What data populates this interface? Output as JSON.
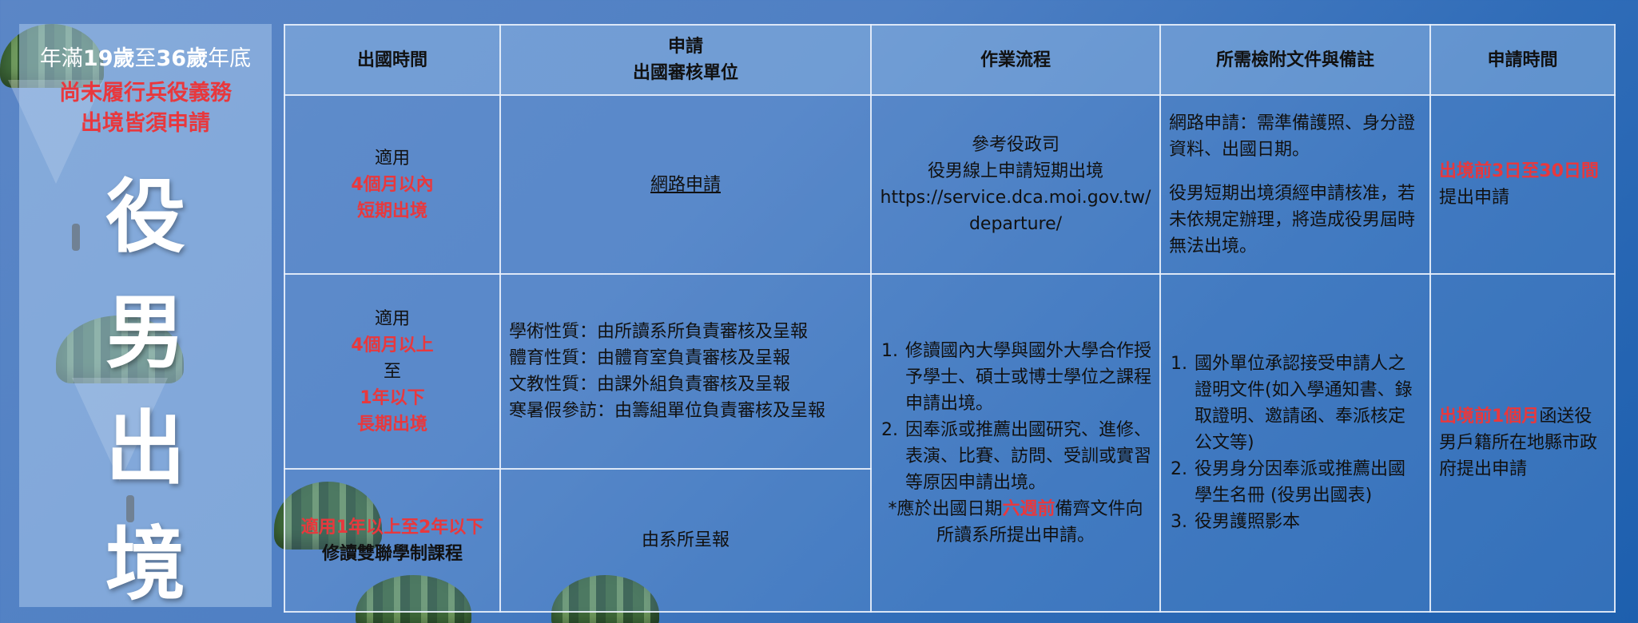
{
  "sidebar": {
    "line1_a": "年滿",
    "line1_b": "19歲",
    "line1_c": "至",
    "line1_d": "36歲",
    "line1_e": "年底",
    "line2": "尚未履行兵役義務",
    "line3": "出境皆須申請",
    "char1": "役",
    "char2": "男",
    "char3": "出",
    "char4": "境"
  },
  "table": {
    "headers": {
      "time": "出國時間",
      "unit_line1": "申請",
      "unit_line2": "出國審核單位",
      "process": "作業流程",
      "docs": "所需檢附文件與備註",
      "apply_time": "申請時間"
    },
    "row1": {
      "time_a": "適用",
      "time_b": "4個月以內",
      "time_c": "短期出境",
      "unit": "網路申請",
      "process_1": "參考役政司",
      "process_2": "役男線上申請短期出境",
      "process_3": "https://service.dca.moi.gov.tw/",
      "process_4": "departure/",
      "docs_1": "網路申請：需準備護照、身分證資料、出國日期。",
      "docs_2": "役男短期出境須經申請核准，若未依規定辦理，將造成役男屆時無法出境。",
      "apply_red": "出境前3日至30日間",
      "apply_rest": "提出申請"
    },
    "row2": {
      "time_a": "適用",
      "time_b": "4個月以上",
      "time_c": "至",
      "time_d": "1年以下",
      "time_e": "長期出境",
      "unit_1": "學術性質：由所讀系所負責審核及呈報",
      "unit_2": "體育性質：由體育室負責審核及呈報",
      "unit_3": "文教性質：由課外組負責審核及呈報",
      "unit_4": "寒暑假參訪：由籌組單位負責審核及呈報",
      "process_item1": "修讀國內大學與國外大學合作授予學士、碩士或博士學位之課程申請出境。",
      "process_item2": "因奉派或推薦出國研究、進修、表演、比賽、訪問、受訓或實習等原因申請出境。",
      "process_note_a": "*應於出國日期",
      "process_note_red": "六週前",
      "process_note_b": "備齊文件向所讀系所提出申請。",
      "docs_item1": "國外單位承認接受申請人之證明文件(如入學通知書、錄取證明、邀請函、奉派核定公文等)",
      "docs_item2": "役男身分因奉派或推薦出國學生名冊 (役男出國表)",
      "docs_item3": "役男護照影本",
      "apply_red": "出境前1個月",
      "apply_rest": "函送役男戶籍所在地縣市政府提出申請"
    },
    "row3": {
      "time_red": "適用1年以上至2年以下",
      "time_b": "修讀雙聯學制課程",
      "unit": "由系所呈報"
    }
  },
  "colors": {
    "accent_red": "#e8383d",
    "grid_line": "#ebf2fc",
    "background": "#4f80c4"
  }
}
